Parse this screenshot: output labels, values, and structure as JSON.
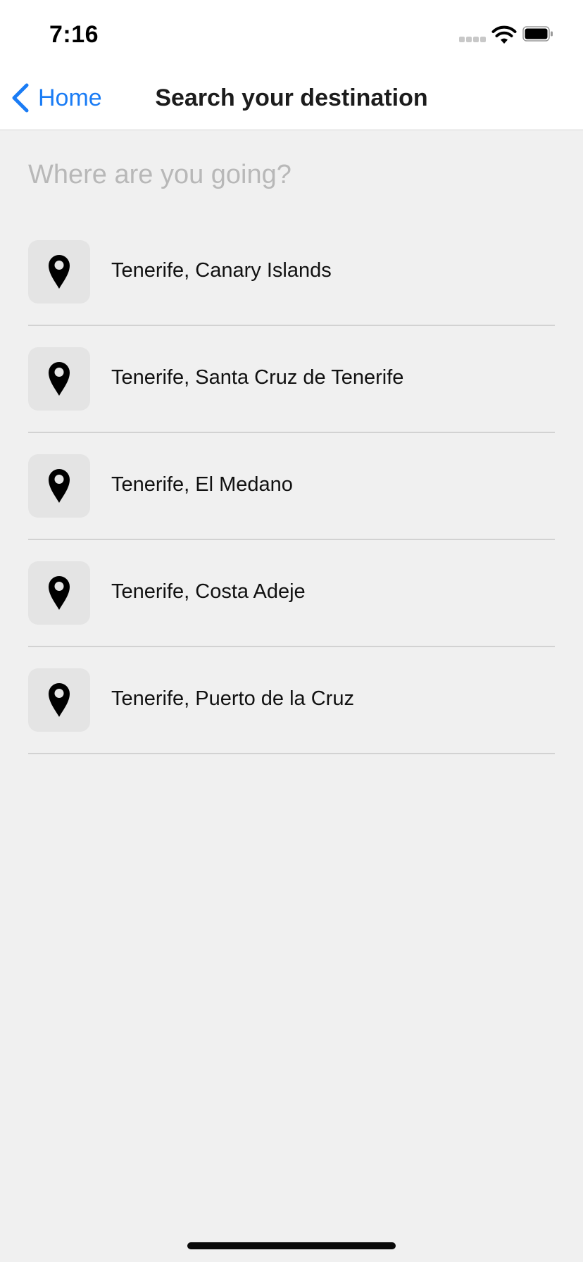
{
  "status_bar": {
    "time": "7:16",
    "icons": [
      "cellular-signal-icon",
      "wifi-icon",
      "battery-icon"
    ]
  },
  "nav": {
    "back_label": "Home",
    "back_icon": "chevron-left-icon",
    "title": "Search your destination"
  },
  "search": {
    "placeholder": "Where are you going?",
    "value": ""
  },
  "results": [
    {
      "icon": "map-pin-icon",
      "label": "Tenerife, Canary Islands"
    },
    {
      "icon": "map-pin-icon",
      "label": "Tenerife, Santa Cruz de Tenerife"
    },
    {
      "icon": "map-pin-icon",
      "label": "Tenerife, El Medano"
    },
    {
      "icon": "map-pin-icon",
      "label": "Tenerife, Costa Adeje"
    },
    {
      "icon": "map-pin-icon",
      "label": "Tenerife, Puerto de la Cruz"
    }
  ],
  "colors": {
    "accent": "#1a7cf5",
    "background": "#f0f0f0",
    "bar_background": "#ffffff",
    "icon_tile": "#e4e4e4",
    "placeholder": "#b8b8b8",
    "divider": "#d2d2d2"
  }
}
